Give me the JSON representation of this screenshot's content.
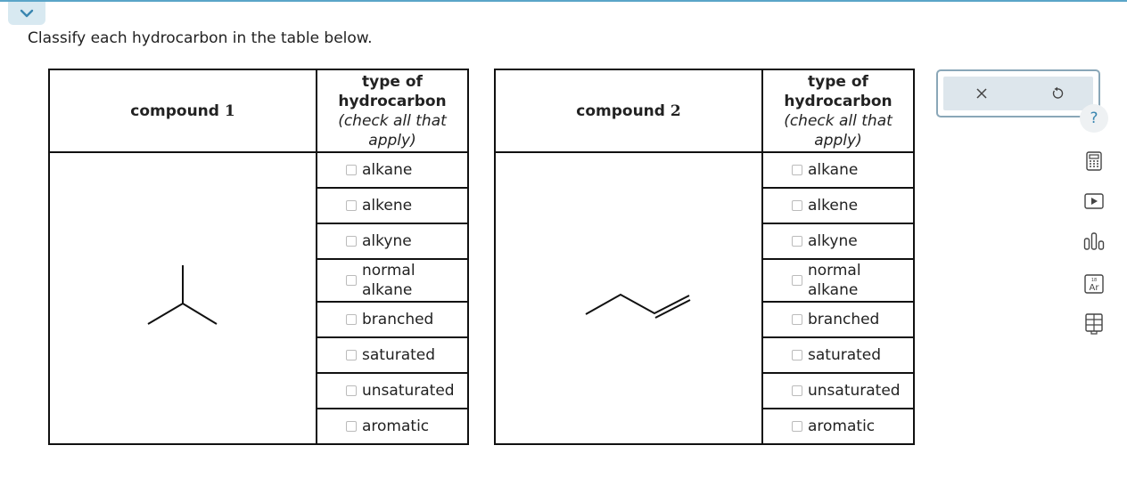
{
  "prompt": "Classify each hydrocarbon in the table below.",
  "tables": [
    {
      "compound_word": "compound",
      "compound_num": "1",
      "type_header": {
        "line1": "type of",
        "line2": "hydrocarbon",
        "line3": "(check all that",
        "line4": "apply)"
      },
      "options": [
        "alkane",
        "alkene",
        "alkyne",
        "normal alkane",
        "branched",
        "saturated",
        "unsaturated",
        "aromatic"
      ]
    },
    {
      "compound_word": "compound",
      "compound_num": "2",
      "type_header": {
        "line1": "type of",
        "line2": "hydrocarbon",
        "line3": "(check all that",
        "line4": "apply)"
      },
      "options": [
        "alkane",
        "alkene",
        "alkyne",
        "normal alkane",
        "branched",
        "saturated",
        "unsaturated",
        "aromatic"
      ]
    }
  ],
  "normal_alkane_split": {
    "line1": "normal",
    "line2": "alkane"
  },
  "tools": {
    "close_icon": "x-icon",
    "undo_icon": "undo-icon",
    "help_label": "?"
  },
  "side_icons": [
    "help-icon",
    "calculator-icon",
    "video-icon",
    "chart-icon",
    "periodic-table-icon",
    "data-sheet-icon"
  ],
  "periodic_tile": {
    "number": "18",
    "symbol": "Ar"
  },
  "colors": {
    "accent": "#5aa5c8",
    "tool_bg": "#dde6ec",
    "border": "#111111"
  }
}
